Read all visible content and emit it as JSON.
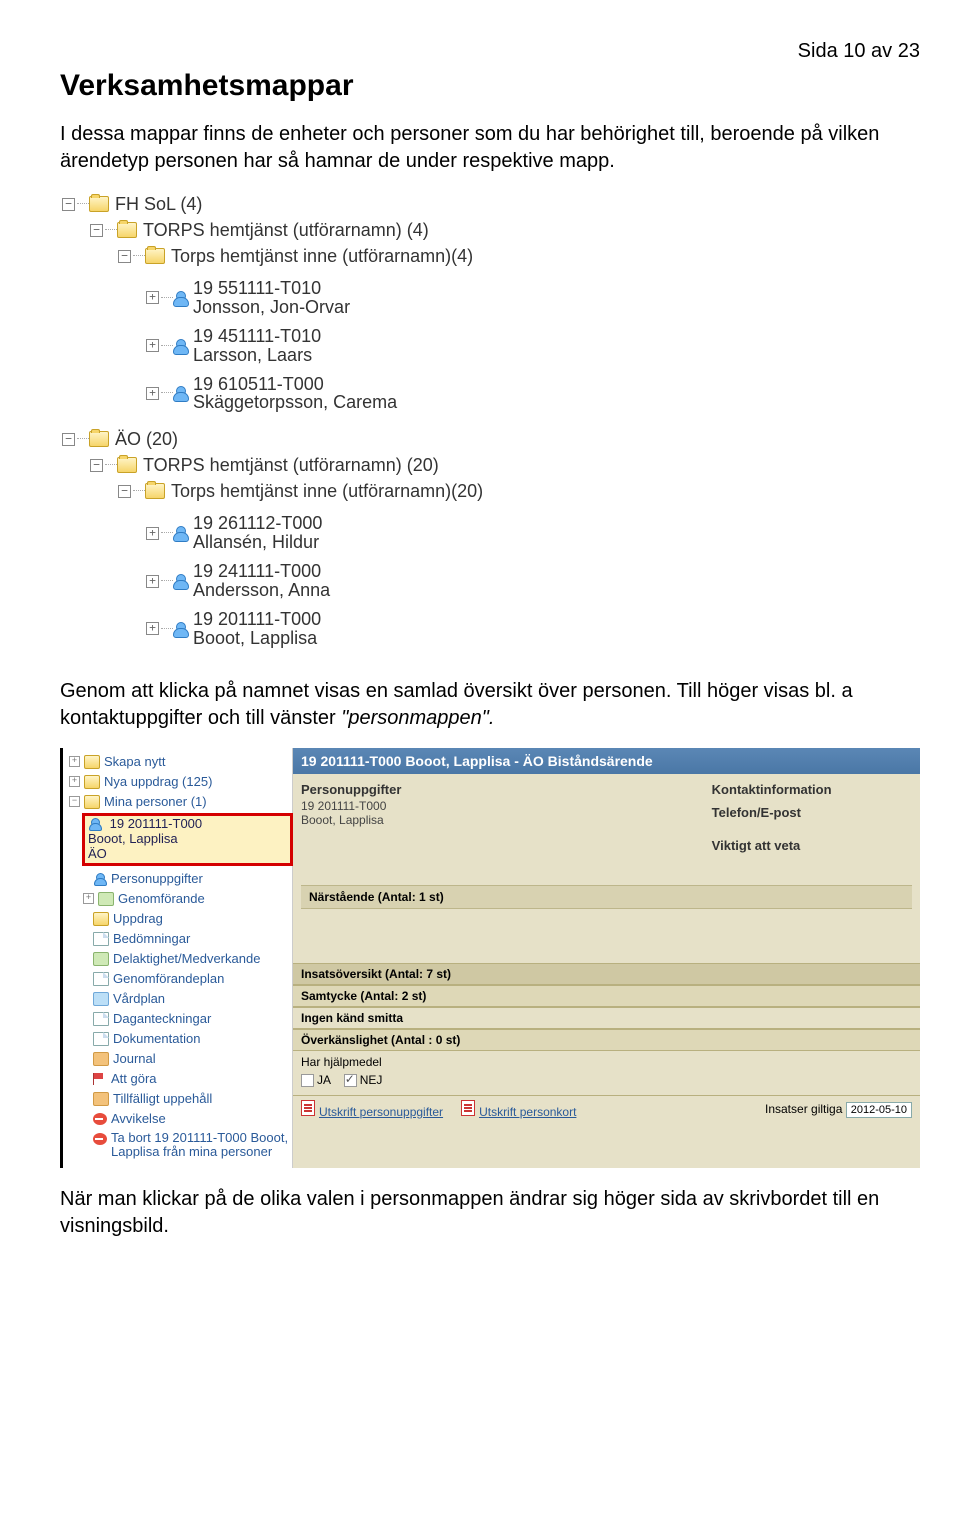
{
  "page_number": "Sida 10 av 23",
  "title": "Verksamhetsmappar",
  "intro": "I dessa mappar finns de enheter och personer som du har behörighet till, beroende på vilken ärendetyp personen har så hamnar de under respektive mapp.",
  "tree": {
    "fh_sol": "FH SoL (4)",
    "torps_ut_4": "TORPS hemtjänst (utförarnamn) (4)",
    "torps_inne_4": "Torps hemtjänst inne (utförarnamn)(4)",
    "p1_id": "19 551111-T010",
    "p1_name": "Jonsson, Jon-Orvar",
    "p2_id": "19 451111-T010",
    "p2_name": "Larsson, Laars",
    "p3_id": "19 610511-T000",
    "p3_name": "Skäggetorpsson, Carema",
    "ao_20": "ÄO (20)",
    "torps_ut_20": "TORPS hemtjänst (utförarnamn) (20)",
    "torps_inne_20": "Torps hemtjänst inne (utförarnamn)(20)",
    "p4_id": "19 261112-T000",
    "p4_name": "Allansén, Hildur",
    "p5_id": "19 241111-T000",
    "p5_name": "Andersson, Anna",
    "p6_id": "19 201111-T000",
    "p6_name": "Booot, Lapplisa"
  },
  "mid_text_1": "Genom att klicka på namnet visas en samlad översikt över personen. Till höger visas bl. a kontaktuppgifter och till vänster ",
  "mid_text_italic": "\"personmappen\".",
  "panel": {
    "left": {
      "skapa": "Skapa nytt",
      "nya": "Nya uppdrag (125)",
      "mina": "Mina personer (1)",
      "sel_id": "19 201111-T000",
      "sel_name": "Booot, Lapplisa",
      "sel_ao": "ÄO",
      "personuppg": "Personuppgifter",
      "genomforande": "Genomförande",
      "uppdrag": "Uppdrag",
      "bedomningar": "Bedömningar",
      "delaktighet": "Delaktighet/Medverkande",
      "genomplan": "Genomförandeplan",
      "vardplan": "Vårdplan",
      "dagant": "Daganteckningar",
      "dokumentation": "Dokumentation",
      "journal": "Journal",
      "attgora": "Att göra",
      "tillfalligt": "Tillfälligt uppehåll",
      "avvikelse": "Avvikelse",
      "tabort": "Ta bort 19 201111-T000 Booot, Lapplisa från mina personer"
    },
    "title": "19 201111-T000 Booot, Lapplisa - ÄO Biståndsärende",
    "body": {
      "personuppgifter": "Personuppgifter",
      "pid": "19 201111-T000",
      "pname": "Booot, Lapplisa",
      "kontakt": "Kontaktinformation",
      "teleepost": "Telefon/E-post",
      "viktigt": "Viktigt att veta",
      "narstaende": "Närstående (Antal: 1 st)",
      "insats": "Insatsöversikt (Antal: 7 st)",
      "samtycke": "Samtycke (Antal: 2 st)",
      "smitta": "Ingen känd smitta",
      "overkans": "Överkänslighet (Antal : 0 st)",
      "hjalpmedel": "Har hjälpmedel",
      "ja": "JA",
      "nej": "NEJ",
      "utskr1": "Utskrift personuppgifter",
      "utskr2": "Utskrift personkort",
      "ins_gilt": "Insatser giltiga",
      "date": "2012-05-10"
    }
  },
  "bottom": "När man klickar på de olika valen i personmappen ändrar sig höger sida av skrivbordet till en visningsbild."
}
